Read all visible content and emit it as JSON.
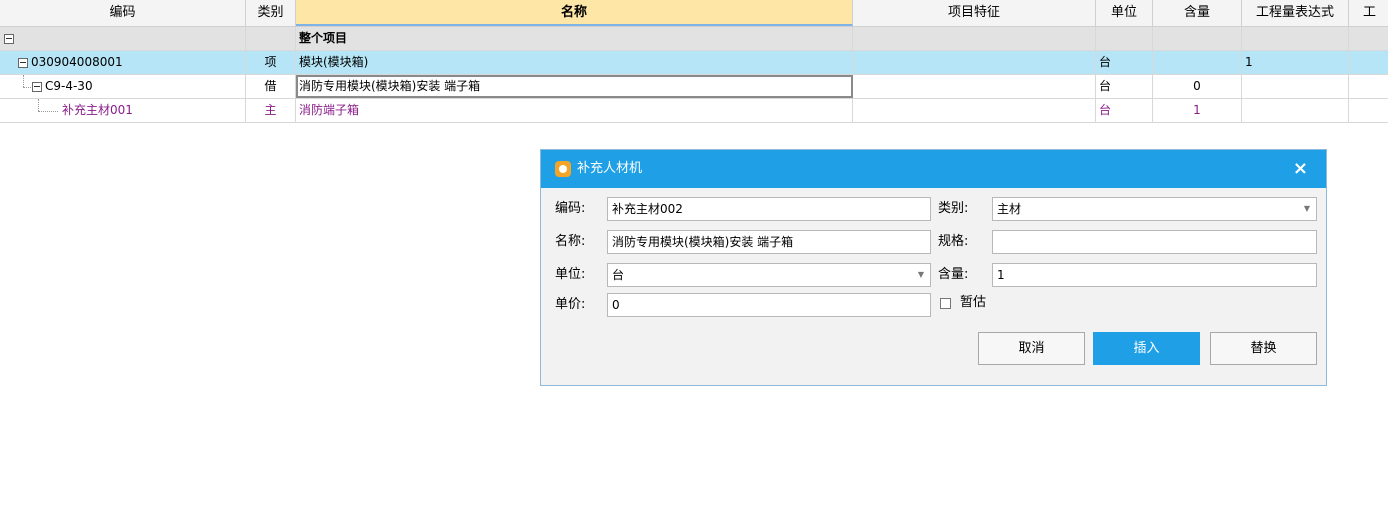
{
  "grid": {
    "headers": [
      "编码",
      "类别",
      "名称",
      "项目特征",
      "单位",
      "含量",
      "工程量表达式",
      "工"
    ],
    "rows": [
      {
        "code": "",
        "type": "",
        "name": "整个项目",
        "feature": "",
        "unit": "",
        "qty": "",
        "expr": ""
      },
      {
        "code": "030904008001",
        "type": "项",
        "name": "模块(模块箱)",
        "feature": "",
        "unit": "台",
        "qty": "",
        "expr": "1"
      },
      {
        "code": "C9-4-30",
        "type": "借",
        "name": "消防专用模块(模块箱)安装 端子箱",
        "feature": "",
        "unit": "台",
        "qty": "0",
        "expr": ""
      },
      {
        "code": "补充主材001",
        "type": "主",
        "name": "消防端子箱",
        "feature": "",
        "unit": "台",
        "qty": "1",
        "expr": ""
      }
    ]
  },
  "dialog": {
    "title": "补充人材机",
    "close": "×",
    "code_label": "编码:",
    "code_value": "补充主材002",
    "category_label": "类别:",
    "category_value": "主材",
    "name_label": "名称:",
    "name_value": "消防专用模块(模块箱)安装 端子箱",
    "spec_label": "规格:",
    "spec_value": "",
    "unit_label": "单位:",
    "unit_value": "台",
    "qty_label": "含量:",
    "qty_value": "1",
    "price_label": "单价:",
    "price_value": "0",
    "estimate_label": "暂估",
    "estimate_checked": false,
    "cancel": "取消",
    "insert": "插入",
    "replace": "替换"
  },
  "colors": {
    "accent": "#1fa0e6",
    "selected_row": "#b5e5f7",
    "active_header": "#fde6a6",
    "material_text": "#8a1d8a"
  },
  "icons": [
    "collapse-icon",
    "app-icon",
    "close-icon",
    "dropdown-icon"
  ]
}
